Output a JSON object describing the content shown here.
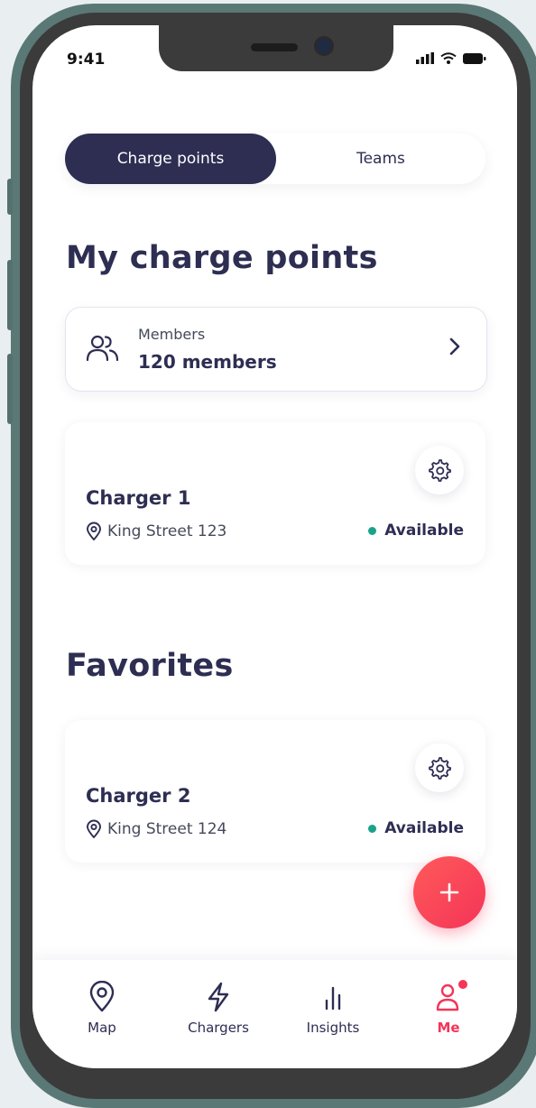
{
  "status_bar": {
    "time": "9:41"
  },
  "tabs": [
    {
      "label": "Charge points",
      "active": true
    },
    {
      "label": "Teams",
      "active": false
    }
  ],
  "sections": {
    "my_charge_points_title": "My charge points",
    "favorites_title": "Favorites"
  },
  "members": {
    "label": "Members",
    "count": "120 members"
  },
  "chargers": [
    {
      "name": "Charger 1",
      "address": "King Street 123",
      "status": "Available"
    },
    {
      "name": "Charger 2",
      "address": "King Street 124",
      "status": "Available"
    }
  ],
  "bottom_nav": [
    {
      "label": "Map",
      "icon": "map-pin-icon"
    },
    {
      "label": "Chargers",
      "icon": "lightning-icon"
    },
    {
      "label": "Insights",
      "icon": "bar-chart-icon"
    },
    {
      "label": "Me",
      "icon": "user-icon",
      "active": true
    }
  ],
  "colors": {
    "primary": "#2d2e52",
    "accent": "#f43458",
    "available": "#1aa38b"
  }
}
